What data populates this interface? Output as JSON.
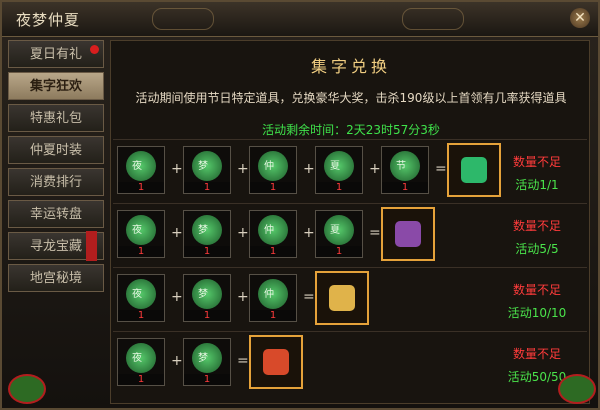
{
  "window": {
    "title": "夜梦仲夏"
  },
  "sidebar": {
    "items": [
      {
        "label": "夏日有礼"
      },
      {
        "label": "集字狂欢"
      },
      {
        "label": "特惠礼包"
      },
      {
        "label": "仲夏时装"
      },
      {
        "label": "消费排行"
      },
      {
        "label": "幸运转盘"
      },
      {
        "label": "寻龙宝藏"
      },
      {
        "label": "地宫秘境"
      }
    ]
  },
  "panel": {
    "heading": "集字兑换",
    "description": "活动期间使用节日特定道具，兑换豪华大奖，击杀190级以上首领有几率获得道具",
    "timer": "活动剩余时间：2天23时57分3秒"
  },
  "recipes": [
    {
      "chars": [
        "夜",
        "梦",
        "仲",
        "夏",
        "节"
      ],
      "counts": [
        "1",
        "1",
        "1",
        "1",
        "1"
      ],
      "status": "数量不足",
      "progress": "活动1/1"
    },
    {
      "chars": [
        "夜",
        "梦",
        "仲",
        "夏"
      ],
      "counts": [
        "1",
        "1",
        "1",
        "1"
      ],
      "status": "数量不足",
      "progress": "活动5/5"
    },
    {
      "chars": [
        "夜",
        "梦",
        "仲"
      ],
      "counts": [
        "1",
        "1",
        "1"
      ],
      "status": "数量不足",
      "progress": "活动10/10"
    },
    {
      "chars": [
        "夜",
        "梦"
      ],
      "counts": [
        "1",
        "1"
      ],
      "status": "数量不足",
      "progress": "活动50/50"
    }
  ],
  "symbols": {
    "plus": "+",
    "equals": "=",
    "close": "✕"
  }
}
